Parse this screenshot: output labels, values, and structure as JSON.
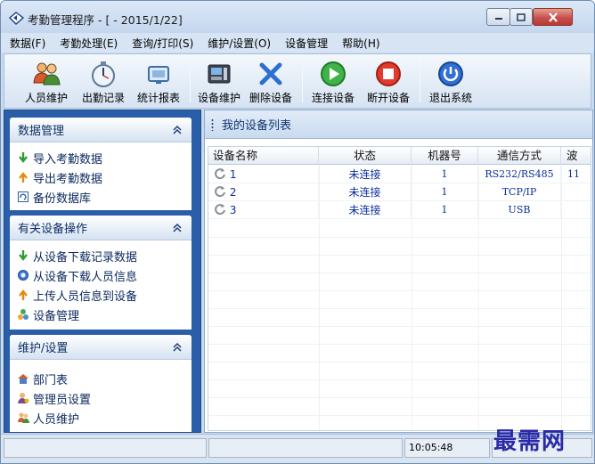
{
  "window": {
    "title": "考勤管理程序 - [ - 2015/1/22]"
  },
  "menu": [
    "数据(F)",
    "考勤处理(E)",
    "查询/打印(S)",
    "维护/设置(O)",
    "设备管理",
    "帮助(H)"
  ],
  "toolbar": {
    "buttons": [
      {
        "label": "人员维护",
        "icon": "users-icon"
      },
      {
        "label": "出勤记录",
        "icon": "stopwatch-icon"
      },
      {
        "label": "统计报表",
        "icon": "report-icon"
      },
      {
        "label": "设备维护",
        "icon": "device-icon"
      },
      {
        "label": "删除设备",
        "icon": "delete-x-icon"
      },
      {
        "label": "连接设备",
        "icon": "connect-play-icon"
      },
      {
        "label": "断开设备",
        "icon": "disconnect-stop-icon"
      },
      {
        "label": "退出系统",
        "icon": "power-icon"
      }
    ]
  },
  "sidebar": {
    "panels": [
      {
        "title": "数据管理",
        "items": [
          "导入考勤数据",
          "导出考勤数据",
          "备份数据库"
        ]
      },
      {
        "title": "有关设备操作",
        "items": [
          "从设备下载记录数据",
          "从设备下载人员信息",
          "上传人员信息到设备",
          "设备管理"
        ]
      },
      {
        "title": "维护/设置",
        "items": [
          "部门表",
          "管理员设置",
          "人员维护"
        ]
      }
    ]
  },
  "content": {
    "title": "我的设备列表",
    "columns": [
      "设备名称",
      "状态",
      "机器号",
      "通信方式",
      "波"
    ],
    "rows": [
      {
        "name": "1",
        "status": "未连接",
        "machine": "1",
        "comm": "RS232/RS485",
        "baud": "11"
      },
      {
        "name": "2",
        "status": "未连接",
        "machine": "1",
        "comm": "TCP/IP",
        "baud": ""
      },
      {
        "name": "3",
        "status": "未连接",
        "machine": "1",
        "comm": "USB",
        "baud": ""
      }
    ]
  },
  "status": {
    "time": "10:05:48"
  },
  "watermark": "最需网",
  "colors": {
    "sidebar_bg": "#2b5ea8",
    "link_text": "#0b2f9c",
    "accent": "#2a2aa8"
  }
}
